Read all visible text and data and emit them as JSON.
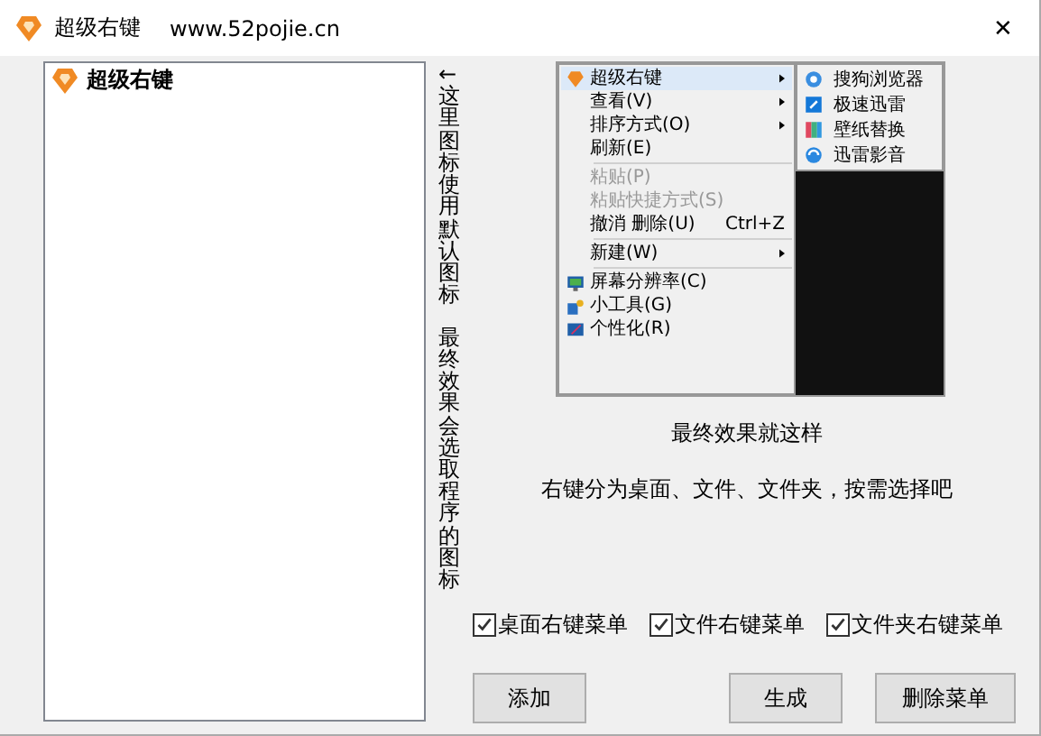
{
  "window": {
    "title": "超级右键",
    "subtitle": "www.52pojie.cn",
    "close": "✕"
  },
  "list": {
    "items": [
      {
        "label": "超级右键",
        "selected": false
      }
    ]
  },
  "notes": [
    "←这里图标使用默认图标",
    "最终效果会选取程序的图标"
  ],
  "preview": {
    "menu": [
      {
        "kind": "item",
        "label": "超级右键",
        "submenu": true,
        "selected": true,
        "disabled": false
      },
      {
        "kind": "item",
        "label": "查看(V)",
        "submenu": true,
        "selected": false,
        "disabled": false
      },
      {
        "kind": "item",
        "label": "排序方式(O)",
        "submenu": true,
        "selected": false,
        "disabled": false
      },
      {
        "kind": "item",
        "label": "刷新(E)",
        "submenu": false,
        "selected": false,
        "disabled": false
      },
      {
        "kind": "separator"
      },
      {
        "kind": "item",
        "label": "粘贴(P)",
        "submenu": false,
        "selected": false,
        "disabled": true
      },
      {
        "kind": "item",
        "label": "粘贴快捷方式(S)",
        "submenu": false,
        "selected": false,
        "disabled": true
      },
      {
        "kind": "item",
        "label": "撤消 删除(U)",
        "shortcut": "Ctrl+Z",
        "submenu": false,
        "selected": false,
        "disabled": false
      },
      {
        "kind": "separator"
      },
      {
        "kind": "item",
        "label": "新建(W)",
        "submenu": true,
        "selected": false,
        "disabled": false
      },
      {
        "kind": "separator"
      },
      {
        "kind": "item",
        "label": "屏幕分辨率(C)",
        "submenu": false,
        "selected": false,
        "disabled": false
      },
      {
        "kind": "item",
        "label": "小工具(G)",
        "submenu": false,
        "selected": false,
        "disabled": false
      },
      {
        "kind": "item",
        "label": "个性化(R)",
        "submenu": false,
        "selected": false,
        "disabled": false
      }
    ],
    "submenu": [
      {
        "label": "搜狗浏览器"
      },
      {
        "label": "极速迅雷"
      },
      {
        "label": "壁纸替换"
      },
      {
        "label": "迅雷影音"
      }
    ]
  },
  "captions": [
    "最终效果就这样",
    "右键分为桌面、文件、文件夹，按需选择吧"
  ],
  "checkboxes": [
    {
      "label": "桌面右键菜单",
      "checked": true
    },
    {
      "label": "文件右键菜单",
      "checked": true
    },
    {
      "label": "文件夹右键菜单",
      "checked": true
    }
  ],
  "buttons": {
    "left": [
      "添加"
    ],
    "right": [
      "生成",
      "删除菜单"
    ]
  }
}
